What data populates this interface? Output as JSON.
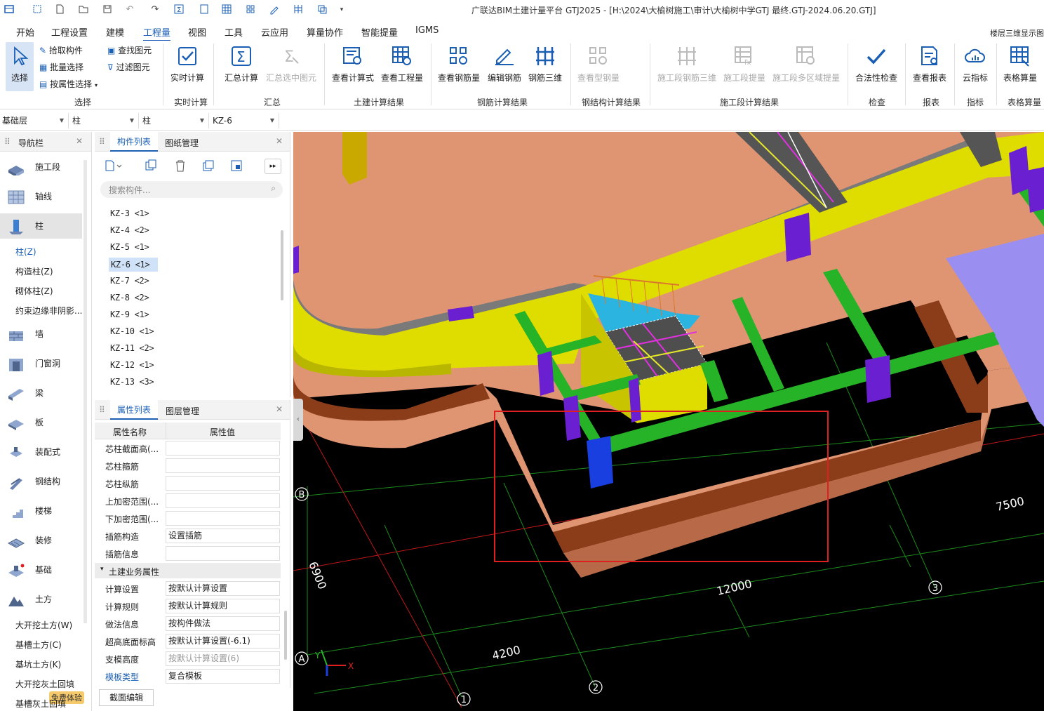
{
  "app": {
    "title": "广联达BIM土建计量平台 GTJ2025 - [H:\\2024\\大榆树施工\\审计\\大榆树中学GTJ 最终.GTJ-2024.06.20.GTJ]"
  },
  "menu": {
    "items": [
      "开始",
      "工程设置",
      "建模",
      "工程量",
      "视图",
      "工具",
      "云应用",
      "算量协作",
      "智能提量",
      "IGMS"
    ],
    "active": "工程量",
    "right_label": "楼层三维显示图"
  },
  "ribbon": {
    "select": {
      "big": "选择",
      "small": [
        "拾取构件",
        "批量选择",
        "按属性选择"
      ],
      "small2": [
        "查找图元",
        "过滤图元"
      ],
      "group": "选择"
    },
    "realtime": {
      "label": "实时计算",
      "group": "实时计算"
    },
    "summary": {
      "labels": [
        "汇总计算",
        "汇总选中图元"
      ],
      "group": "汇总"
    },
    "civil": {
      "labels": [
        "查看计算式",
        "查看工程量"
      ],
      "group": "土建计算结果"
    },
    "rebar": {
      "labels": [
        "查看钢筋量",
        "编辑钢筋",
        "钢筋三维"
      ],
      "group": "钢筋计算结果"
    },
    "steel": {
      "labels": [
        "查看型钢量"
      ],
      "group": "钢结构计算结果"
    },
    "stage": {
      "labels": [
        "施工段钢筋三维",
        "施工段提量",
        "施工段多区域提量"
      ],
      "group": "施工段计算结果"
    },
    "check": {
      "label": "合法性检查",
      "group": "检查"
    },
    "report": {
      "label": "查看报表",
      "group": "报表"
    },
    "index": {
      "label": "云指标",
      "group": "指标"
    },
    "table": {
      "label": "表格算量",
      "group": "表格算量"
    }
  },
  "combos": {
    "floor": "基础层",
    "category": "柱",
    "type": "柱",
    "component": "KZ-6"
  },
  "nav": {
    "title": "导航栏",
    "items": [
      "施工段",
      "轴线",
      "柱",
      "墙",
      "门窗洞",
      "梁",
      "板",
      "装配式",
      "钢结构",
      "楼梯",
      "装修",
      "基础",
      "土方"
    ],
    "column_sub": [
      "柱(Z)",
      "构造柱(Z)",
      "砌体柱(Z)",
      "约束边缘非阴影..."
    ],
    "earth_sub": [
      "大开挖土方(W)",
      "基槽土方(C)",
      "基坑土方(K)",
      "大开挖灰土回填",
      "基槽灰土回填"
    ],
    "badge": "免费体验"
  },
  "components": {
    "tabs": [
      "构件列表",
      "图纸管理"
    ],
    "search_placeholder": "搜索构件...",
    "items": [
      "KZ-3 <1>",
      "KZ-4 <2>",
      "KZ-5 <1>",
      "KZ-6 <1>",
      "KZ-7 <2>",
      "KZ-8 <2>",
      "KZ-9 <1>",
      "KZ-10 <1>",
      "KZ-11 <2>",
      "KZ-12 <1>",
      "KZ-13 <3>"
    ],
    "selected": "KZ-6 <1>"
  },
  "properties": {
    "tabs": [
      "属性列表",
      "图层管理"
    ],
    "headers": [
      "属性名称",
      "属性值"
    ],
    "rows": [
      {
        "name": "芯柱截面高(...",
        "value": ""
      },
      {
        "name": "芯柱箍筋",
        "value": ""
      },
      {
        "name": "芯柱纵筋",
        "value": ""
      },
      {
        "name": "上加密范围(...",
        "value": ""
      },
      {
        "name": "下加密范围(...",
        "value": ""
      },
      {
        "name": "插筋构造",
        "value": "设置插筋"
      },
      {
        "name": "插筋信息",
        "value": ""
      }
    ],
    "section": "土建业务属性",
    "rows2": [
      {
        "name": "计算设置",
        "value": "按默认计算设置"
      },
      {
        "name": "计算规则",
        "value": "按默认计算规则"
      },
      {
        "name": "做法信息",
        "value": "按构件做法"
      },
      {
        "name": "超高底面标高",
        "value": "按默认计算设置(-6.1)"
      },
      {
        "name": "支模高度",
        "value": "按默认计算设置(6)"
      },
      {
        "name": "模板类型",
        "value": "复合模板"
      }
    ],
    "button": "截面编辑"
  },
  "viewport": {
    "axis_labels": [
      "A",
      "B",
      "1",
      "2",
      "3"
    ],
    "dimensions": [
      "6900",
      "12000",
      "4200",
      "7500"
    ],
    "gizmo": [
      "X",
      "Y"
    ],
    "colors": {
      "slab": "#e09572",
      "beam_yellow": "#dfdc00",
      "beam_green": "#27b327",
      "column_purple": "#6a1fd0",
      "column_blue": "#1a3fe0",
      "highlight_box": "#e02020"
    }
  }
}
